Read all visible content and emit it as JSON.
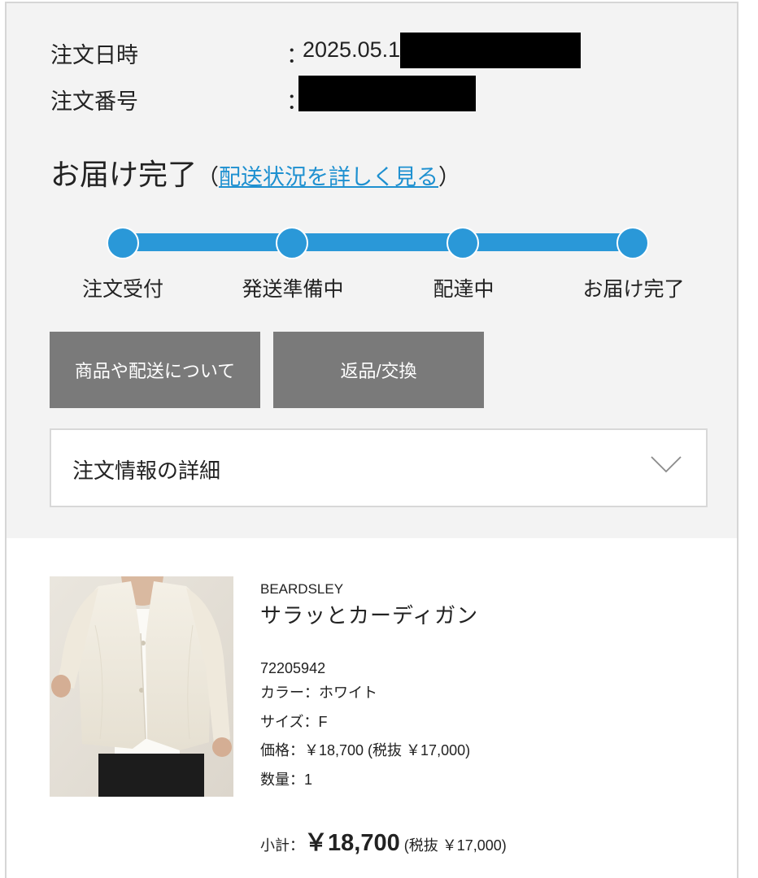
{
  "order": {
    "date_label": "注文日時",
    "date_colon": "：",
    "date_value": "2025.05.1",
    "number_label": "注文番号",
    "number_colon": "："
  },
  "status": {
    "title": "お届け完了",
    "paren_open": "（",
    "link": "配送状況を詳しく見る",
    "paren_close": "）",
    "accent_color": "#2a98d8",
    "current_step": 4,
    "steps": [
      "注文受付",
      "発送準備中",
      "配達中",
      "お届け完了"
    ]
  },
  "buttons": {
    "about": "商品や配送について",
    "returns": "返品/交換"
  },
  "details": {
    "title": "注文情報の詳細",
    "icon": "chevron-down-icon"
  },
  "product": {
    "brand": "BEARDSLEY",
    "name": "サラッとカーディガン",
    "code": "72205942",
    "color": "カラー：ホワイト",
    "size": "サイズ：F",
    "price": "価格：￥18,700 (税抜 ￥17,000)",
    "quantity": "数量：1",
    "subtotal_label": "小計：",
    "subtotal_amount": "￥18,700",
    "subtotal_tax": " (税抜 ￥17,000)"
  }
}
